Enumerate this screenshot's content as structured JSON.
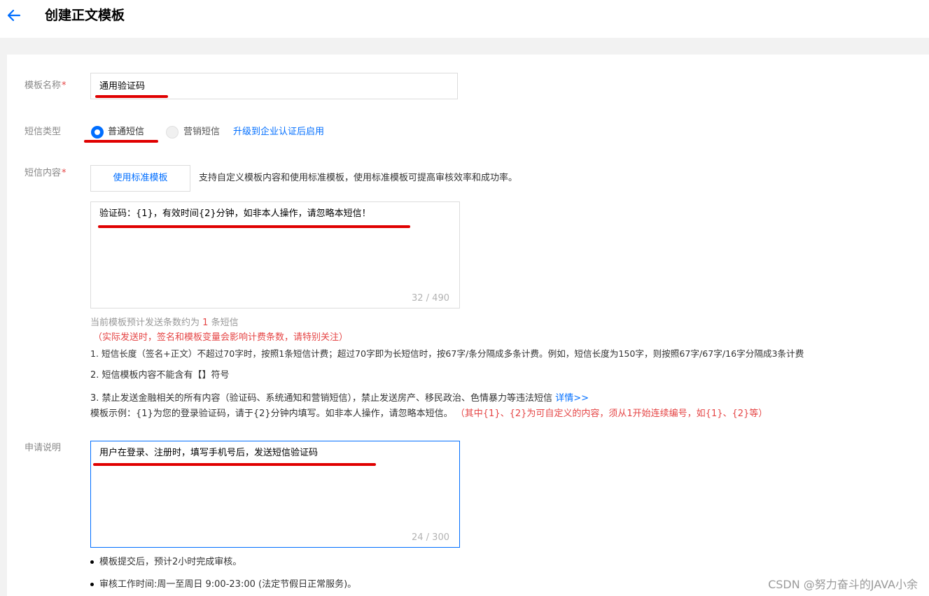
{
  "header": {
    "title": "创建正文模板"
  },
  "form": {
    "name": {
      "label": "模板名称",
      "required_mark": "*",
      "value": "通用验证码"
    },
    "type": {
      "label": "短信类型",
      "options": [
        {
          "label": "普通短信",
          "selected": true
        },
        {
          "label": "营销短信",
          "selected": false
        }
      ],
      "upgrade_link": "升级到企业认证后启用"
    },
    "content": {
      "label": "短信内容",
      "required_mark": "*",
      "std_button": "使用标准模板",
      "hint": "支持自定义模板内容和使用标准模板，使用标准模板可提高审核效率和成功率。",
      "value": "验证码：{1}，有效时间{2}分钟，如非本人操作，请忽略本短信！",
      "count": "32 / 490",
      "estimate_prefix": "当前模板预计发送条数约为",
      "estimate_count": "1",
      "estimate_suffix": "条短信",
      "warning": "（实际发送时，签名和模板变量会影响计费条数，请特别关注）",
      "rules": [
        "1. 短信长度（签名+正文）不超过70字时，按照1条短信计费；超过70字即为长短信时，按67字/条分隔成多条计费。例如，短信长度为150字，则按照67字/67字/16字分隔成3条计费",
        "2. 短信模板内容不能含有【】符号",
        "3. 禁止发送金融相关的所有内容（验证码、系统通知和营销短信），禁止发送房产、移民政治、色情暴力等违法短信"
      ],
      "rule3_link": "详情>>",
      "example_prefix": "模板示例：{1}为您的登录验证码，请于{2}分钟内填写。如非本人操作，请忽略本短信。",
      "example_note": "（其中{1}、{2}为可自定义的内容，须从1开始连续编号，如{1}、{2}等）"
    },
    "description": {
      "label": "申请说明",
      "value": "用户在登录、注册时，填写手机号后，发送短信验证码",
      "count": "24 / 300"
    },
    "notes": [
      "模板提交后，预计2小时完成审核。",
      "审核工作时间:周一至周日 9:00-23:00 (法定节假日正常服务)。"
    ]
  },
  "watermark": "CSDN @努力奋斗的JAVA小余",
  "colors": {
    "accent": "#006eff",
    "required": "#e54545",
    "annotation": "#e00000"
  }
}
